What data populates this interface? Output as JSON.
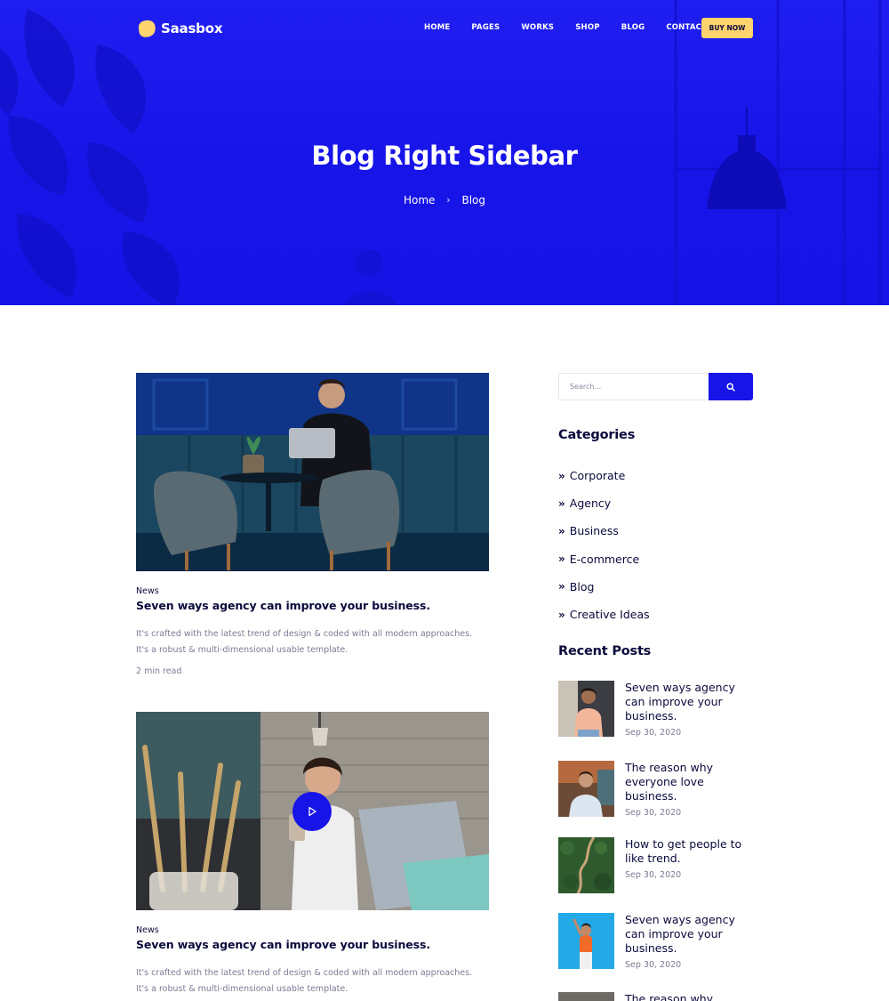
{
  "brand": {
    "name": "Saasbox",
    "accent": "#1714e8",
    "highlight": "#ffd36e"
  },
  "nav": {
    "items": [
      {
        "label": "HOME"
      },
      {
        "label": "PAGES"
      },
      {
        "label": "WORKS"
      },
      {
        "label": "SHOP"
      },
      {
        "label": "BLOG"
      },
      {
        "label": "CONTACT"
      }
    ],
    "cta": "BUY NOW"
  },
  "hero": {
    "title": "Blog Right Sidebar",
    "breadcrumb": {
      "home": "Home",
      "current": "Blog"
    }
  },
  "posts": [
    {
      "tag": "News",
      "title": "Seven ways agency can improve your business.",
      "excerpt_line1": "It's crafted with the latest trend of design & coded with all modern approaches.",
      "excerpt_line2": "It's a robust & multi-dimensional usable template.",
      "meta": "2 min read"
    },
    {
      "tag": "News",
      "title": "Seven ways agency can improve your business.",
      "excerpt_line1": "It's crafted with the latest trend of design & coded with all modern approaches.",
      "excerpt_line2": "It's a robust & multi-dimensional usable template."
    }
  ],
  "sidebar": {
    "search": {
      "placeholder": "Search..."
    },
    "categories": {
      "title": "Categories",
      "items": [
        {
          "label": "Corporate"
        },
        {
          "label": "Agency"
        },
        {
          "label": "Business"
        },
        {
          "label": "E-commerce"
        },
        {
          "label": "Blog"
        },
        {
          "label": "Creative Ideas"
        }
      ]
    },
    "recent": {
      "title": "Recent Posts",
      "items": [
        {
          "line1": "Seven ways agency",
          "line2": "can improve your",
          "line3": "business.",
          "date": "Sep 30, 2020"
        },
        {
          "line1": "The reason why",
          "line2": "everyone love",
          "line3": "business.",
          "date": "Sep 30, 2020"
        },
        {
          "line1": "How to get people to",
          "line2": "like trend.",
          "date": "Sep 30, 2020"
        },
        {
          "line1": "Seven ways agency",
          "line2": "can improve your",
          "line3": "business.",
          "date": "Sep 30, 2020"
        },
        {
          "line1": "The reason why"
        }
      ]
    }
  }
}
